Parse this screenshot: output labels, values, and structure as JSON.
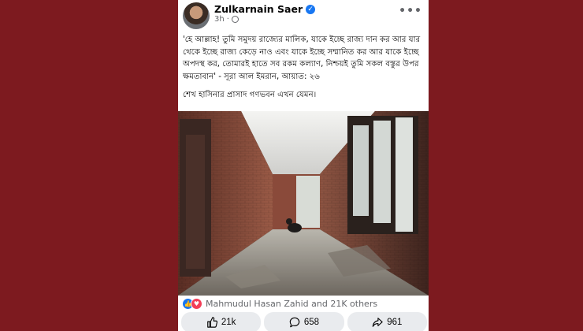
{
  "post": {
    "author_name": "Zulkarnain Saer",
    "time": "3h",
    "separator": "·",
    "more_label": "•••",
    "text_paragraph_1": "'হে আল্লাহ! তুমি সমুদয় রাজ্যের মালিক, যাকে ইচ্ছে রাজ্য দান কর আর যার থেকে ইচ্ছে রাজ্য কেড়ে নাও এবং যাকে ইচ্ছে সম্মানিত কর আর যাকে ইচ্ছে অপদস্থ কর, তোমারই হাতে সব রকম কল্যাণ, নিশ্চয়ই তুমি সকল বস্তুর উপর ক্ষমতাবান' - সূরা আল ইমরান, আয়াত: ২৬",
    "text_paragraph_2": "শেখ হাসিনার প্রাসাদ গণভবন এখন যেমন।"
  },
  "reactions": {
    "summary": "Mahmudul Hasan Zahid and 21K others"
  },
  "actions": {
    "like_count": "21k",
    "comment_count": "658",
    "share_count": "961"
  },
  "icons": {
    "like": "thumbs-up-icon",
    "comment": "comment-bubble-icon",
    "share": "share-arrow-icon",
    "globe": "globe-icon",
    "verified": "verified-badge-icon"
  },
  "colors": {
    "background": "#7d1a1f",
    "brand_blue": "#1877f2",
    "love_red": "#f33e58",
    "button_bg": "#e9ebee"
  }
}
